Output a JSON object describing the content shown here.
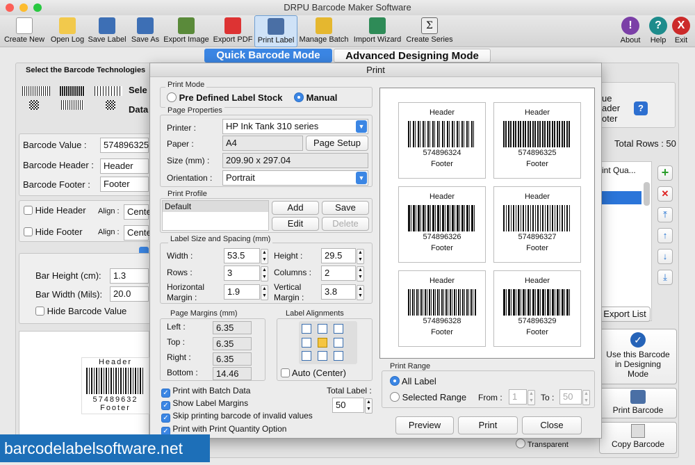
{
  "window": {
    "title": "DRPU Barcode Maker Software"
  },
  "toolbar": {
    "items": [
      {
        "label": "Create New",
        "icon": "new-file-icon"
      },
      {
        "label": "Open Log",
        "icon": "open-folder-icon"
      },
      {
        "label": "Save Label",
        "icon": "save-icon"
      },
      {
        "label": "Save As",
        "icon": "save-as-icon"
      },
      {
        "label": "Export Image",
        "icon": "export-image-icon"
      },
      {
        "label": "Export PDF",
        "icon": "export-pdf-icon"
      },
      {
        "label": "Print Label",
        "icon": "printer-icon"
      },
      {
        "label": "Manage Batch",
        "icon": "manage-batch-icon"
      },
      {
        "label": "Import Wizard",
        "icon": "import-wizard-icon"
      },
      {
        "label": "Create Series",
        "icon": "series-icon"
      }
    ],
    "right": [
      {
        "label": "About",
        "glyph": "!"
      },
      {
        "label": "Help",
        "glyph": "?"
      },
      {
        "label": "Exit",
        "glyph": "X"
      }
    ]
  },
  "modes": {
    "quick": "Quick Barcode Mode",
    "advanced": "Advanced Designing Mode"
  },
  "bg": {
    "select_tech": "Select the Barcode Technologies",
    "sel": "Sele",
    "dat": "Data",
    "barcode_value_label": "Barcode Value :",
    "barcode_value": "574896325",
    "barcode_header_label": "Barcode Header :",
    "barcode_header": "Header",
    "barcode_footer_label": "Barcode Footer :",
    "barcode_footer": "Footer",
    "hide_header": "Hide Header",
    "hide_footer": "Hide Footer",
    "align": "Align :",
    "align_val": "Cente",
    "bar_height_label": "Bar Height (cm):",
    "bar_height": "1.3",
    "bar_width_label": "Bar Width (Mils):",
    "bar_width": "20.0",
    "hide_barcode_value": "Hide Barcode Value",
    "preview_header": "Header",
    "preview_value": "57489632",
    "preview_footer": "Footer",
    "ue": "ue",
    "ader": "ader",
    "oter": "oter",
    "total_rows": "Total Rows : 50",
    "print_qua": "rint Qua...",
    "export_list": "Export List",
    "use_designing": "Use this Barcode in Designing Mode",
    "print_barcode": "Print Barcode",
    "copy_barcode": "Copy Barcode",
    "transparent": "Transparent"
  },
  "dialog": {
    "title": "Print",
    "print_mode": {
      "title": "Print Mode",
      "option1": "Pre Defined Label Stock",
      "option2": "Manual",
      "selected": "Manual"
    },
    "page_props": {
      "title": "Page Properties",
      "printer_label": "Printer :",
      "printer": "HP Ink Tank 310 series",
      "paper_label": "Paper :",
      "paper": "A4",
      "page_setup": "Page Setup",
      "size_label": "Size (mm) :",
      "size": "209.90 x 297.04",
      "orientation_label": "Orientation :",
      "orientation": "Portrait"
    },
    "print_profile": {
      "title": "Print Profile",
      "items": [
        "Default"
      ],
      "add": "Add",
      "save": "Save",
      "edit": "Edit",
      "delete": "Delete"
    },
    "label_size": {
      "title": "Label Size and Spacing (mm)",
      "width_label": "Width :",
      "width": "53.5",
      "height_label": "Height :",
      "height": "29.5",
      "rows_label": "Rows :",
      "rows": "3",
      "cols_label": "Columns :",
      "cols": "2",
      "hmargin_label": "Horizontal Margin :",
      "hmargin": "1.9",
      "vmargin_label": "Vertical Margin :",
      "vmargin": "3.8"
    },
    "page_margins": {
      "title": "Page Margins (mm)",
      "left_label": "Left :",
      "left": "6.35",
      "top_label": "Top :",
      "top": "6.35",
      "right_label": "Right :",
      "right": "6.35",
      "bottom_label": "Bottom :",
      "bottom": "14.46"
    },
    "alignments": {
      "title": "Label Alignments",
      "auto": "Auto (Center)"
    },
    "options": {
      "batch": "Print with Batch Data",
      "margins": "Show Label Margins",
      "skip": "Skip printing barcode of invalid values",
      "qty": "Print with Print Quantity Option"
    },
    "total_label": {
      "label": "Total Label :",
      "value": "50"
    },
    "preview_labels": [
      {
        "header": "Header",
        "value": "574896324",
        "footer": "Footer"
      },
      {
        "header": "Header",
        "value": "574896325",
        "footer": "Footer"
      },
      {
        "header": "Header",
        "value": "574896326",
        "footer": "Footer"
      },
      {
        "header": "Header",
        "value": "574896327",
        "footer": "Footer"
      },
      {
        "header": "Header",
        "value": "574896328",
        "footer": "Footer"
      },
      {
        "header": "Header",
        "value": "574896329",
        "footer": "Footer"
      }
    ],
    "print_range": {
      "title": "Print Range",
      "all": "All Label",
      "selected": "Selected Range",
      "from_label": "From :",
      "from": "1",
      "to_label": "To :",
      "to": "50"
    },
    "buttons": {
      "preview": "Preview",
      "print": "Print",
      "close": "Close"
    }
  },
  "watermark": "barcodelabelsoftware.net"
}
